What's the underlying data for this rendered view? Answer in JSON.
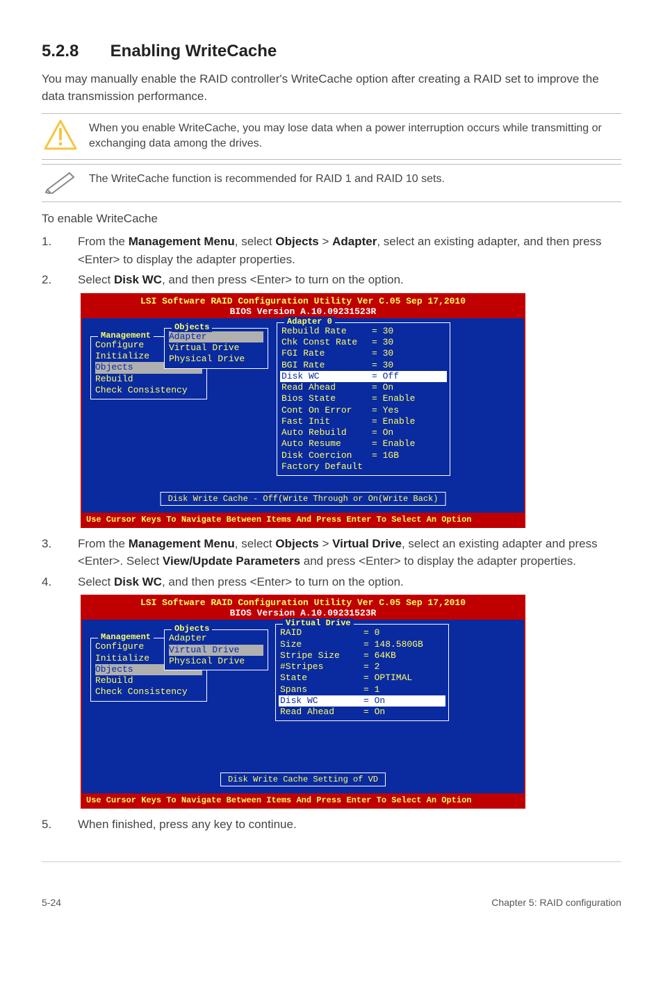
{
  "section": {
    "number": "5.2.8",
    "title": "Enabling WriteCache"
  },
  "intro": "You may manually enable the RAID controller's WriteCache option after creating a RAID set to improve the data transmission performance.",
  "warning_note": "When you enable WriteCache, you may lose data when a power interruption occurs while transmitting or exchanging data among the drives.",
  "tip_note": "The WriteCache function is recommended for RAID 1 and RAID 10 sets.",
  "subhead": "To enable WriteCache",
  "step1": {
    "num": "1.",
    "pre": "From the ",
    "b1": "Management Menu",
    "mid1": ", select ",
    "b2": "Objects",
    "gt": " > ",
    "b3": "Adapter",
    "tail": ", select an existing adapter, and then press <Enter> to display the adapter properties."
  },
  "step2": {
    "num": "2.",
    "pre": "Select ",
    "b1": "Disk WC",
    "tail": ", and then press <Enter> to turn on the option."
  },
  "step3": {
    "num": "3.",
    "pre": "From the ",
    "b1": "Management Menu",
    "mid1": ", select ",
    "b2": "Objects",
    "gt": " > ",
    "b3": "Virtual Drive",
    "mid2": ", select an existing adapter and press <Enter>. Select ",
    "b4": "View/Update Parameters",
    "tail": " and press <Enter> to display the adapter properties."
  },
  "step4": {
    "num": "4.",
    "pre": "Select ",
    "b1": "Disk WC",
    "tail": ", and then press <Enter> to turn on the option."
  },
  "step5": {
    "num": "5.",
    "text": "When finished, press any key to continue."
  },
  "bios": {
    "title": "LSI Software RAID Configuration Utility Ver C.05 Sep 17,2010",
    "version": "BIOS Version  A.10.09231523R",
    "mgmt_legend": "Management",
    "mgmt_items": [
      "Configure",
      "Initialize",
      "Objects",
      "Rebuild",
      "Check Consistency"
    ],
    "obj_legend": "Objects",
    "obj_items": [
      "Adapter",
      "Virtual Drive",
      "Physical Drive"
    ],
    "adapter_legend": "Adapter 0",
    "adapter_rows": [
      {
        "k": "Rebuild Rate",
        "v": "= 30"
      },
      {
        "k": "Chk Const Rate",
        "v": "= 30"
      },
      {
        "k": "FGI Rate",
        "v": "= 30"
      },
      {
        "k": "BGI Rate",
        "v": "= 30"
      },
      {
        "k": "Disk WC",
        "v": "= Off",
        "hl": true
      },
      {
        "k": "Read Ahead",
        "v": "= On"
      },
      {
        "k": "Bios State",
        "v": "= Enable"
      },
      {
        "k": "Cont On Error",
        "v": "= Yes"
      },
      {
        "k": "Fast Init",
        "v": "= Enable"
      },
      {
        "k": "Auto Rebuild",
        "v": "= On"
      },
      {
        "k": "Auto Resume",
        "v": "= Enable"
      },
      {
        "k": "Disk Coercion",
        "v": "= 1GB"
      },
      {
        "k": "Factory Default",
        "v": ""
      }
    ],
    "status1": "Disk Write Cache - Off(Write Through or On(Write Back)",
    "vd_legend": "Virtual Drive",
    "vd_rows": [
      {
        "k": "RAID",
        "v": "= 0"
      },
      {
        "k": "Size",
        "v": "= 148.580GB"
      },
      {
        "k": "Stripe Size",
        "v": "= 64KB"
      },
      {
        "k": "#Stripes",
        "v": "= 2"
      },
      {
        "k": "State",
        "v": "= OPTIMAL"
      },
      {
        "k": "Spans",
        "v": "= 1"
      },
      {
        "k": "Disk WC",
        "v": "= On",
        "hl": true
      },
      {
        "k": "Read Ahead",
        "v": "= On"
      }
    ],
    "status2": "Disk Write Cache Setting of VD",
    "footer": "Use Cursor Keys To Navigate Between Items And Press Enter To Select An Option"
  },
  "page_footer": {
    "left": "5-24",
    "right": "Chapter 5: RAID configuration"
  }
}
